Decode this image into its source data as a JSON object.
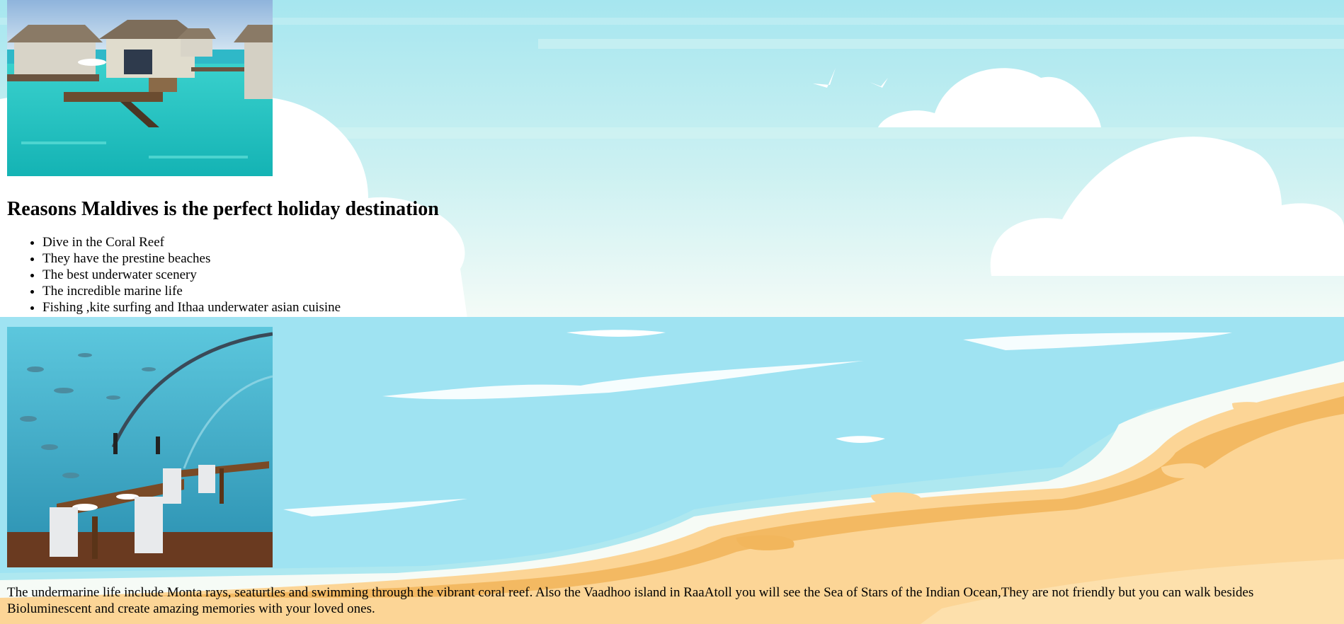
{
  "images": {
    "top": "overwater-villas-photo",
    "bottom": "underwater-restaurant-photo"
  },
  "heading": "Reasons Maldives is the perfect holiday destination",
  "reasons": [
    "Dive in the Coral Reef",
    "They have the prestine beaches",
    "The best underwater scenery",
    "The incredible marine life",
    "Fishing ,kite surfing and Ithaa underwater asian cuisine"
  ],
  "paragraph": "The undermarine life include Monta rays, seaturtles and swimming through the vibrant coral reef. Also the Vaadhoo island in RaaAtoll you will see the Sea of Stars of the Indian Ocean,They are not friendly but you can walk besides Bioluminescent and create amazing memories with your loved ones.",
  "colors": {
    "sky": "#aee8f0",
    "sea": "#9fe3f2",
    "sand": "#fcd596",
    "sand_dark": "#f2b65c",
    "cloud": "#ffffff",
    "lagoon": "#2ccfc9"
  }
}
